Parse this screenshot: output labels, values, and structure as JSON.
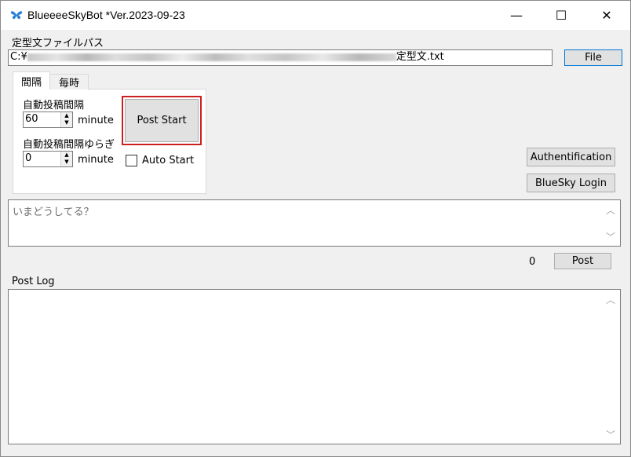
{
  "window": {
    "title": "BlueeeeSkyBot  *Ver.2023-09-23",
    "minimize_glyph": "—",
    "maximize_glyph": "☐",
    "close_glyph": "✕"
  },
  "file_path": {
    "label": "定型文ファイルパス",
    "value_prefix": "C:¥",
    "value_suffix": "定型文.txt",
    "button_label": "File"
  },
  "tabs": [
    {
      "label": "間隔",
      "selected": true
    },
    {
      "label": "毎時",
      "selected": false
    }
  ],
  "interval": {
    "label": "自動投稿間隔",
    "value": "60",
    "unit": "minute",
    "jitter_label": "自動投稿間隔ゆらぎ",
    "jitter_value": "0",
    "jitter_unit": "minute"
  },
  "post_start_button": "Post Start",
  "auto_start_label": "Auto Start",
  "authentification_button": "Authentification",
  "bluesky_login_button": "BlueSky Login",
  "compose": {
    "placeholder": "いまどうしてる？",
    "char_count": "0",
    "post_button": "Post"
  },
  "post_log": {
    "label": "Post Log"
  },
  "colors": {
    "highlight_border": "#cc1f1f",
    "focus_border": "#0078d7",
    "app_icon": "#2a7fd4"
  }
}
